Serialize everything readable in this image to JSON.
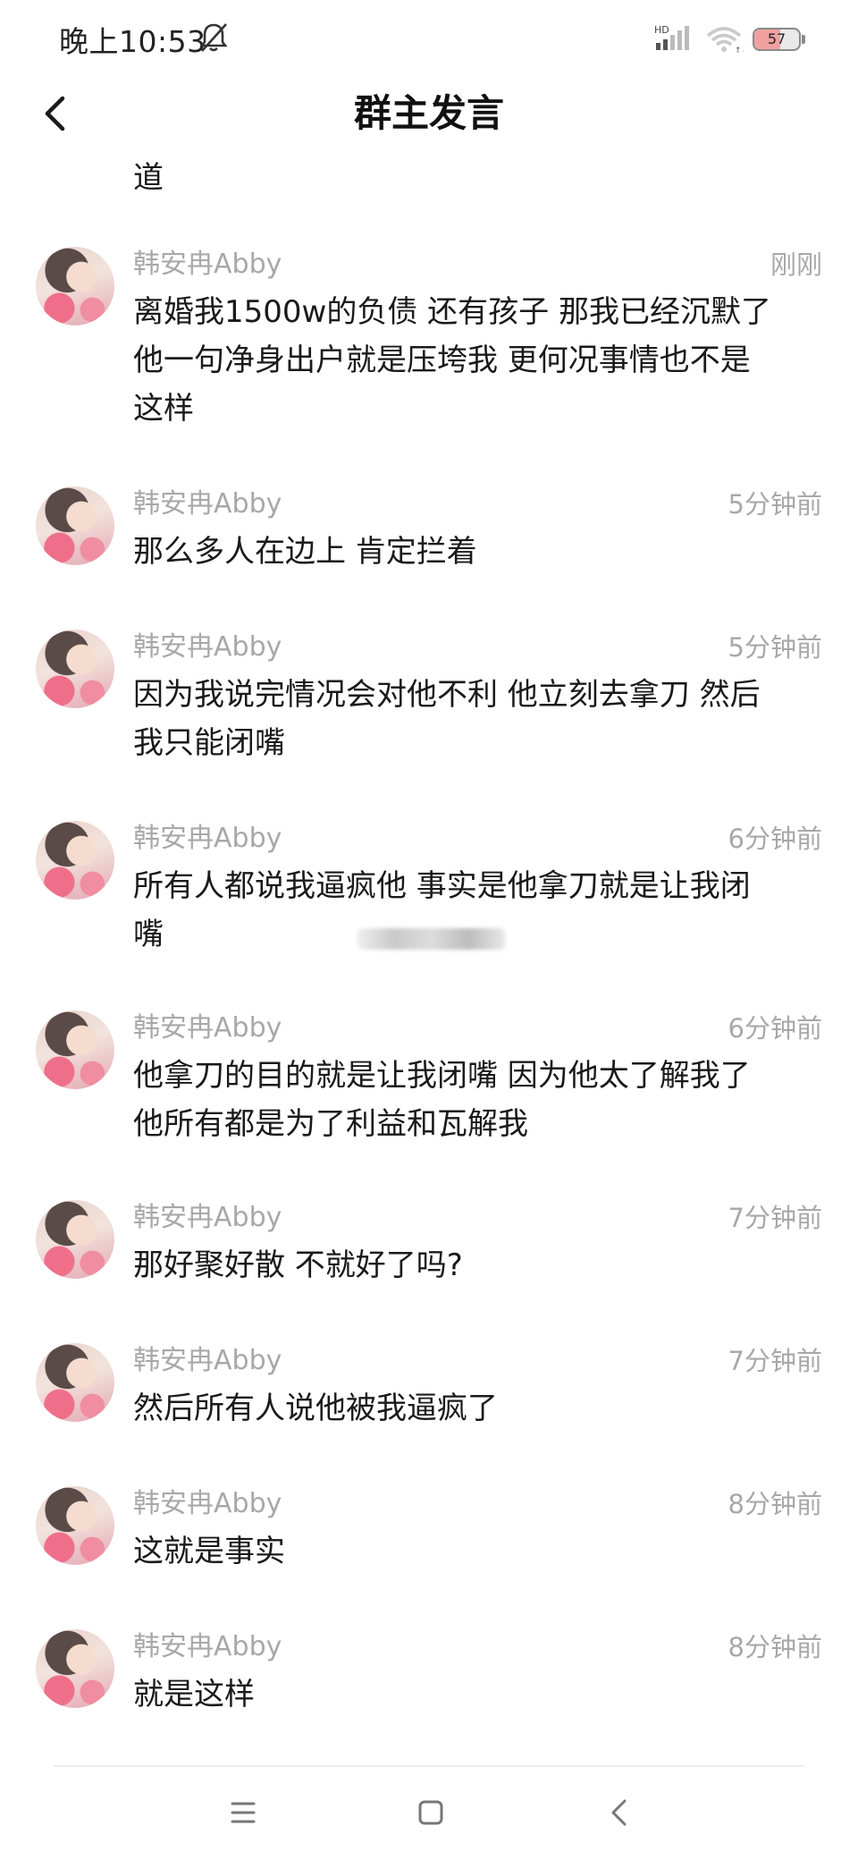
{
  "status_bar": {
    "time": "晚上10:53",
    "network_label": "HD",
    "battery": "57",
    "icons": [
      "bell-off-icon",
      "signal-icon",
      "wifi-icon",
      "battery-icon"
    ]
  },
  "header": {
    "title": "群主发言",
    "back_icon": "chevron-left-icon"
  },
  "chat": {
    "partial_text": "道",
    "messages": [
      {
        "name": "韩安冉Abby",
        "time": "刚刚",
        "text": "离婚我1500w的负债 还有孩子 那我已经沉默了\n他一句净身出户就是压垮我 更何况事情也不是\n这样"
      },
      {
        "name": "韩安冉Abby",
        "time": "5分钟前",
        "text": "那么多人在边上 肯定拦着"
      },
      {
        "name": "韩安冉Abby",
        "time": "5分钟前",
        "text": "因为我说完情况会对他不利 他立刻去拿刀 然后\n我只能闭嘴"
      },
      {
        "name": "韩安冉Abby",
        "time": "6分钟前",
        "text": "所有人都说我逼疯他 事实是他拿刀就是让我闭\n嘴"
      },
      {
        "name": "韩安冉Abby",
        "time": "6分钟前",
        "text": "他拿刀的目的就是让我闭嘴 因为他太了解我了\n他所有都是为了利益和瓦解我"
      },
      {
        "name": "韩安冉Abby",
        "time": "7分钟前",
        "text": "那好聚好散 不就好了吗?"
      },
      {
        "name": "韩安冉Abby",
        "time": "7分钟前",
        "text": "然后所有人说他被我逼疯了"
      },
      {
        "name": "韩安冉Abby",
        "time": "8分钟前",
        "text": "这就是事实"
      },
      {
        "name": "韩安冉Abby",
        "time": "8分钟前",
        "text": "就是这样"
      }
    ]
  },
  "nav_bar": {
    "icons": [
      "menu-icon",
      "home-square-icon",
      "back-chevron-icon"
    ]
  }
}
